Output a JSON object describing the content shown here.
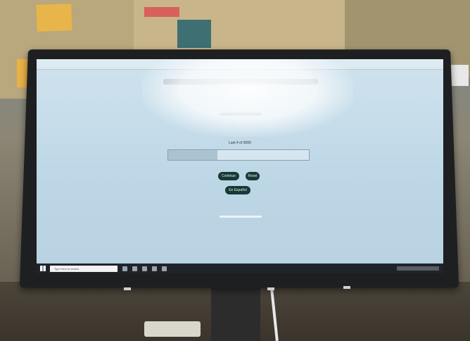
{
  "screen": {
    "progress_text": "Last 4 of 5000",
    "progress_fraction": 0.35,
    "buttons": {
      "continue_label": "Continue",
      "reset_label": "Reset",
      "espanol_label": "En Español"
    },
    "taskbar": {
      "search_placeholder": "Type here to search"
    }
  },
  "colors": {
    "button_bg": "#163a36",
    "screen_bg": "#cfe3ee",
    "taskbar_bg": "#20242a"
  },
  "icons": [
    "windows-start-icon",
    "taskbar-app-icon"
  ]
}
